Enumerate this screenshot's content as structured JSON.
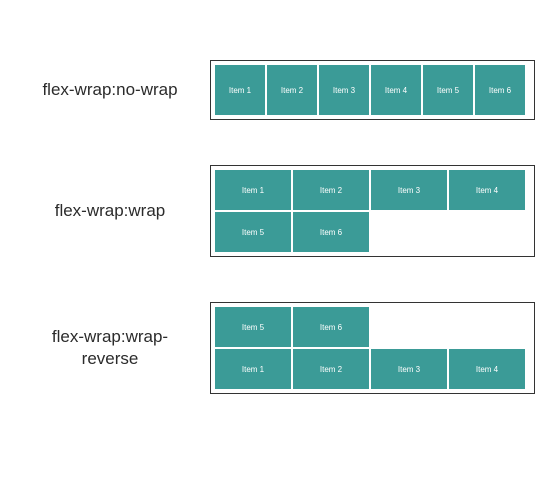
{
  "examples": [
    {
      "label": "flex-wrap:no-wrap",
      "mode": "nowrap",
      "items": [
        "Item 1",
        "Item 2",
        "Item 3",
        "Item 4",
        "Item 5",
        "Item 6"
      ]
    },
    {
      "label": "flex-wrap:wrap",
      "mode": "wrap",
      "items": [
        "Item 1",
        "Item 2",
        "Item 3",
        "Item 4",
        "Item 5",
        "Item 6"
      ]
    },
    {
      "label": "flex-wrap:wrap-reverse",
      "mode": "wrap-reverse",
      "items": [
        "Item 1",
        "Item 2",
        "Item 3",
        "Item 4",
        "Item 5",
        "Item 6"
      ]
    }
  ],
  "colors": {
    "item_bg": "#3b9b97",
    "item_fg": "#ffffff",
    "border": "#333333"
  }
}
